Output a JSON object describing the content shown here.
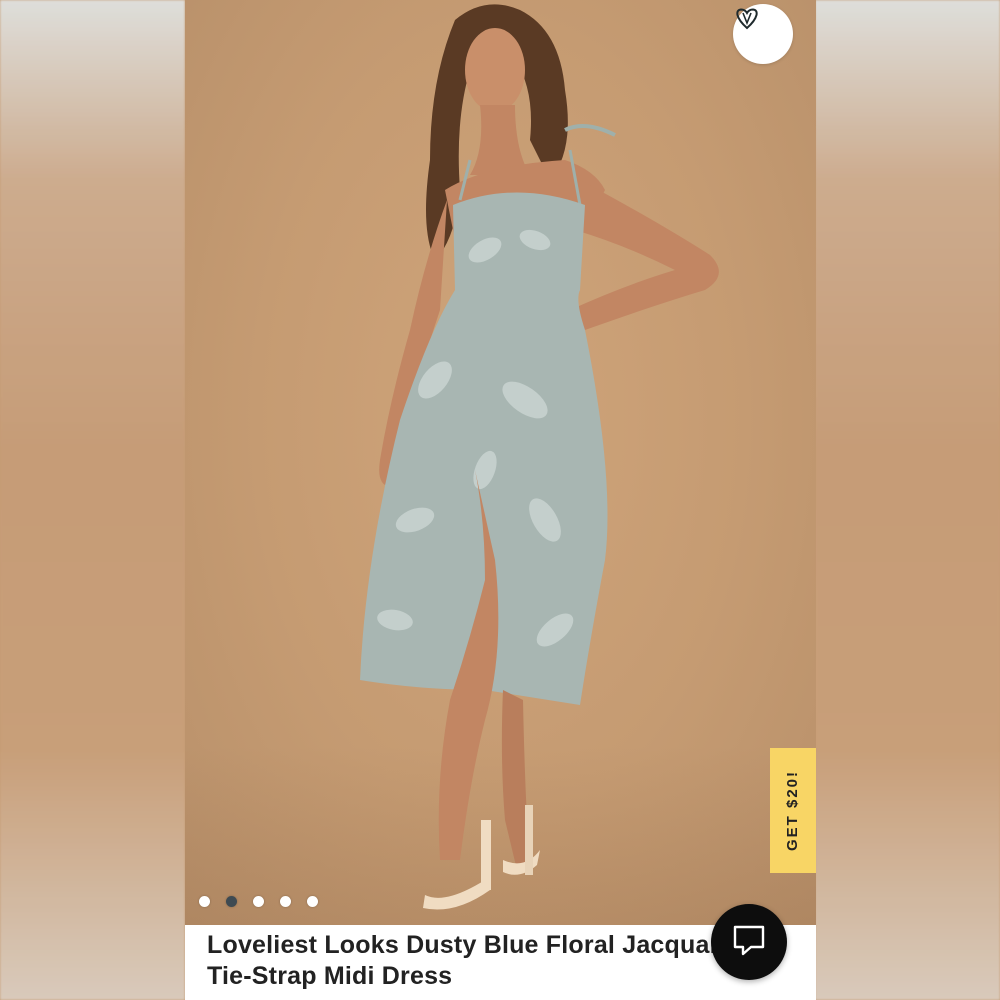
{
  "product": {
    "title": "Loveliest Looks Dusty Blue Floral Jacquard\nTie-Strap Midi Dress",
    "image_count": 5,
    "active_image": 2
  },
  "actions": {
    "favorite_icon": "heart-icon",
    "chat_icon": "chat-bubble-icon"
  },
  "promo": {
    "label": "GET $20!"
  },
  "colors": {
    "backdrop": "#c59b72",
    "dress": "#a8b6b2",
    "promo_tab": "#f8d565",
    "chat_button": "#0d0d0d",
    "active_dot": "#3e4a52"
  }
}
